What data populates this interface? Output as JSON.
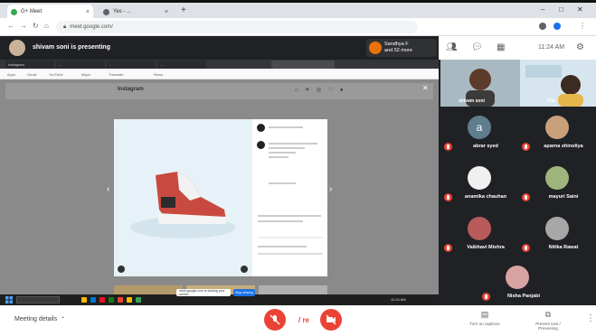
{
  "browser": {
    "active_tab": "G+ Meet",
    "inactive_tab": "Yes - ...",
    "url": "meet.google.com/"
  },
  "meet": {
    "presenting_text": "shivam soni is presenting",
    "join_text_line1": "Sandhya F",
    "join_text_line2": "and 52 more"
  },
  "shared": {
    "inner_tabs": [
      "Instagram",
      "…",
      "…",
      "…",
      "…"
    ],
    "bookmarks": [
      "Apps",
      "Gmail",
      "YouTube",
      "Maps",
      "Translate",
      "News"
    ],
    "site_logo": "Instagram",
    "taskbar_popup": "meet.google.com is sharing your screen",
    "taskbar_button": "Stop sharing",
    "taskbar_clock": "11:24 AM"
  },
  "panel": {
    "time": "11:24 AM",
    "video_tiles": [
      {
        "name": "shivam soni"
      },
      {
        "name": "You"
      }
    ],
    "participants": [
      {
        "name": "abrar syed",
        "initial": "a",
        "color": "#5f7d8c"
      },
      {
        "name": "aparna shinoliya",
        "color": "#c8a07a"
      },
      {
        "name": "anamika chauhan",
        "color": "#f0f0f0"
      },
      {
        "name": "mayuri Saini",
        "color": "#9fb57d"
      },
      {
        "name": "Vaibhavi Mishra",
        "color": "#b85a5a"
      },
      {
        "name": "Nitika Rawat",
        "color": "#a7a7a7"
      },
      {
        "name": "Nisha Panjabi",
        "color": "#d9a3a3"
      }
    ]
  },
  "bottombar": {
    "meeting_details": "Meeting details",
    "hangup_text": "/ re",
    "captions": "Turn on captions",
    "present": "Present now / Presenting",
    "colors": {
      "danger": "#ea4335",
      "accent": "#1a73e8"
    }
  }
}
